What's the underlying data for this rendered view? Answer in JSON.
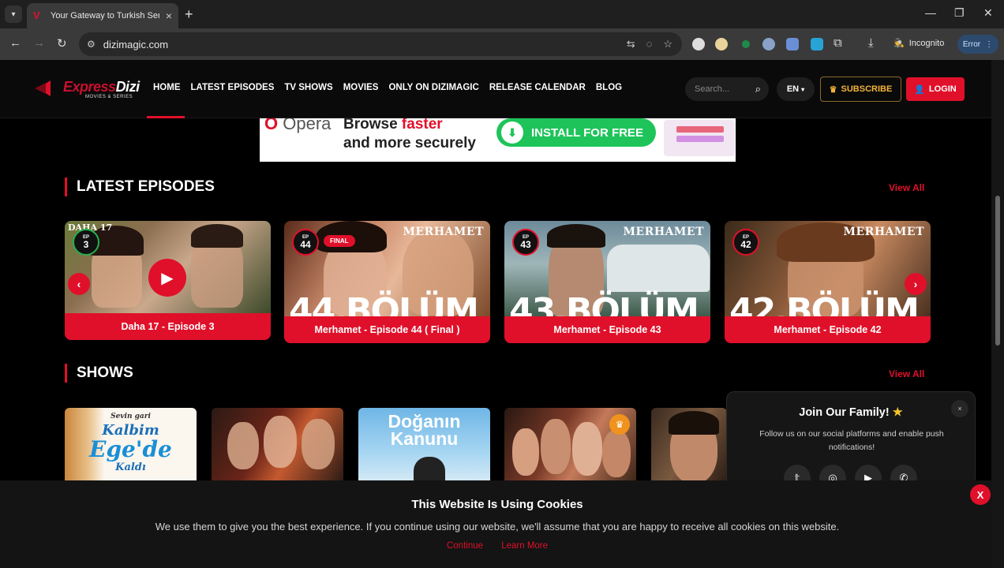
{
  "browser": {
    "tab_title": "Your Gateway to Turkish Series",
    "url": "dizimagic.com",
    "incognito_label": "Incognito",
    "error_label": "Error"
  },
  "site": {
    "logo": {
      "word1": "Express",
      "word2": "Dizi",
      "sub": "MOVIES & SERIES"
    },
    "nav": [
      "HOME",
      "LATEST EPISODES",
      "TV SHOWS",
      "MOVIES",
      "ONLY ON DIZIMAGIC",
      "RELEASE CALENDAR",
      "BLOG"
    ],
    "search_placeholder": "Search...",
    "language": "EN",
    "subscribe_label": "SUBSCRIBE",
    "login_label": "LOGIN"
  },
  "ad": {
    "brand": "Opera",
    "line1a": "Browse ",
    "line1b": "faster",
    "line2": "and more securely",
    "cta": "INSTALL FOR FREE"
  },
  "latest": {
    "title": "LATEST EPISODES",
    "view_all": "View All",
    "episodes": [
      {
        "ep_label": "EP",
        "ep_num": "3",
        "caption": "Daha 17 - Episode 3",
        "show_mark": "DAHA 17"
      },
      {
        "ep_label": "EP",
        "ep_num": "44",
        "caption": "Merhamet - Episode 44 ( Final )",
        "tag": "FINAL",
        "show_mark": "MERHAMET",
        "big": "44.BÖLÜM"
      },
      {
        "ep_label": "EP",
        "ep_num": "43",
        "caption": "Merhamet - Episode 43",
        "show_mark": "MERHAMET",
        "big": "43.BÖLÜM"
      },
      {
        "ep_label": "EP",
        "ep_num": "42",
        "caption": "Merhamet - Episode 42",
        "show_mark": "MERHAMET",
        "big": "42.BÖLÜM"
      }
    ]
  },
  "shows": {
    "title": "SHOWS",
    "view_all": "View All",
    "kalbim": {
      "top": "Sevin gari",
      "l1": "Kalbim",
      "l2": "Ege'de",
      "l3": "Kaldı"
    },
    "dogan": {
      "l1": "Doğanın",
      "l2": "Kanunu"
    }
  },
  "join": {
    "title": "Join Our Family!",
    "star": "★",
    "text": "Follow us on our social platforms and enable push notifications!",
    "close": "×"
  },
  "cookie": {
    "title": "This Website Is Using Cookies",
    "text": "We use them to give you the best experience. If you continue using our website, we'll assume that you are happy to receive all cookies on this website.",
    "continue": "Continue",
    "learn_more": "Learn More",
    "close": "X"
  },
  "colors": {
    "accent": "#e0102a",
    "gold": "#f3b33a",
    "green": "#1ec45a"
  }
}
